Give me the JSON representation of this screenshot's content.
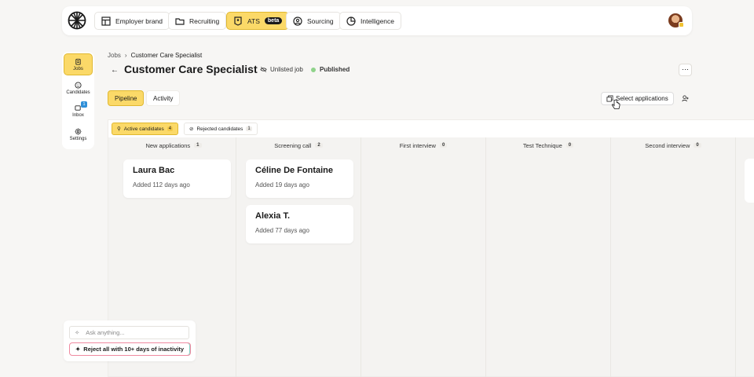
{
  "topnav": {
    "tabs": [
      {
        "label": "Employer brand",
        "icon": "layout-icon"
      },
      {
        "label": "Recruiting",
        "icon": "folder-icon"
      },
      {
        "label": "ATS",
        "icon": "badge-icon",
        "badge": "beta",
        "active": true
      },
      {
        "label": "Sourcing",
        "icon": "user-circle-icon"
      },
      {
        "label": "Intelligence",
        "icon": "pie-chart-icon"
      }
    ]
  },
  "sidebar": {
    "items": [
      {
        "label": "Jobs",
        "icon": "clipboard-icon",
        "active": true
      },
      {
        "label": "Candidates",
        "icon": "smiley-icon"
      },
      {
        "label": "Inbox",
        "icon": "inbox-icon",
        "badge": "1"
      },
      {
        "label": "Settings",
        "icon": "gear-icon"
      }
    ]
  },
  "breadcrumb": {
    "parent": "Jobs",
    "current": "Customer Care Specialist"
  },
  "job": {
    "title": "Customer Care Specialist",
    "visibility": "Unlisted job",
    "status": "Published"
  },
  "subtabs": [
    "Pipeline",
    "Activity"
  ],
  "actions": {
    "select_applications": "Select applications"
  },
  "filters": [
    {
      "label": "Active candidates",
      "count": "4",
      "icon": "pin-icon"
    },
    {
      "label": "Rejected candidates",
      "count": "1",
      "icon": "ban-icon"
    }
  ],
  "columns": [
    {
      "name": "New applications",
      "count": "1",
      "cards": [
        {
          "name": "Laura Bac",
          "added": "Added 112 days ago"
        }
      ]
    },
    {
      "name": "Screening call",
      "count": "2",
      "cards": [
        {
          "name": "Céline De Fontaine",
          "added": "Added 19 days ago"
        },
        {
          "name": "Alexia T.",
          "added": "Added 77 days ago"
        }
      ]
    },
    {
      "name": "First interview",
      "count": "0",
      "cards": []
    },
    {
      "name": "Test Technique",
      "count": "0",
      "cards": []
    },
    {
      "name": "Second interview",
      "count": "0",
      "cards": []
    }
  ],
  "assistant": {
    "placeholder": "Ask anything...",
    "suggestion": "Reject all with 10+ days of inactivity"
  },
  "colors": {
    "accent": "#fbd968",
    "published": "#8fd38a",
    "badge": "#2f8fd8"
  }
}
